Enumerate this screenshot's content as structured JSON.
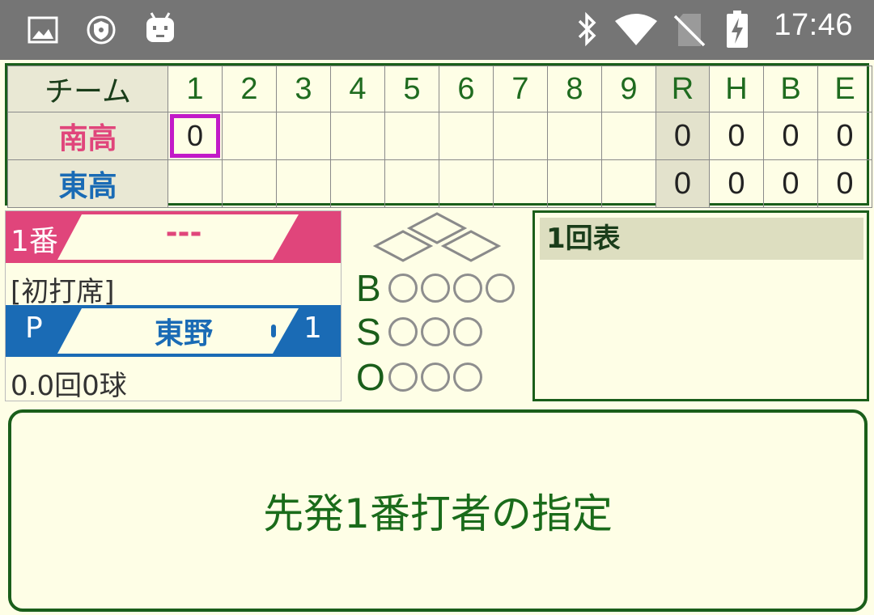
{
  "status_bar": {
    "time": "17:46",
    "icons": [
      "image-icon",
      "shield-icon",
      "android-icon",
      "bluetooth-icon",
      "wifi-icon",
      "no-sim-icon",
      "battery-charging-icon"
    ]
  },
  "scoreboard": {
    "header": {
      "team_label": "チーム",
      "innings": [
        "1",
        "2",
        "3",
        "4",
        "5",
        "6",
        "7",
        "8",
        "9"
      ],
      "totals": [
        "R",
        "H",
        "B",
        "E"
      ]
    },
    "rows": [
      {
        "team": "南高",
        "innings": [
          "0",
          "",
          "",
          "",
          "",
          "",
          "",
          "",
          ""
        ],
        "totals": [
          "0",
          "0",
          "0",
          "0"
        ],
        "color": "#e0457b"
      },
      {
        "team": "東高",
        "innings": [
          "",
          "",
          "",
          "",
          "",
          "",
          "",
          "",
          ""
        ],
        "totals": [
          "0",
          "0",
          "0",
          "0"
        ],
        "color": "#1a6bb5"
      }
    ]
  },
  "batter": {
    "order": "1番",
    "name": "---",
    "note": "[初打席]",
    "color": "#e0457b"
  },
  "pitcher": {
    "pos": "P",
    "name": "東野",
    "number": "1",
    "stats": "0.0回0球",
    "color": "#1a6bb5"
  },
  "count": {
    "ball_label": "B",
    "strike_label": "S",
    "out_label": "O"
  },
  "log": {
    "inning_title": "1回表"
  },
  "action": {
    "label": "先発1番打者の指定"
  }
}
